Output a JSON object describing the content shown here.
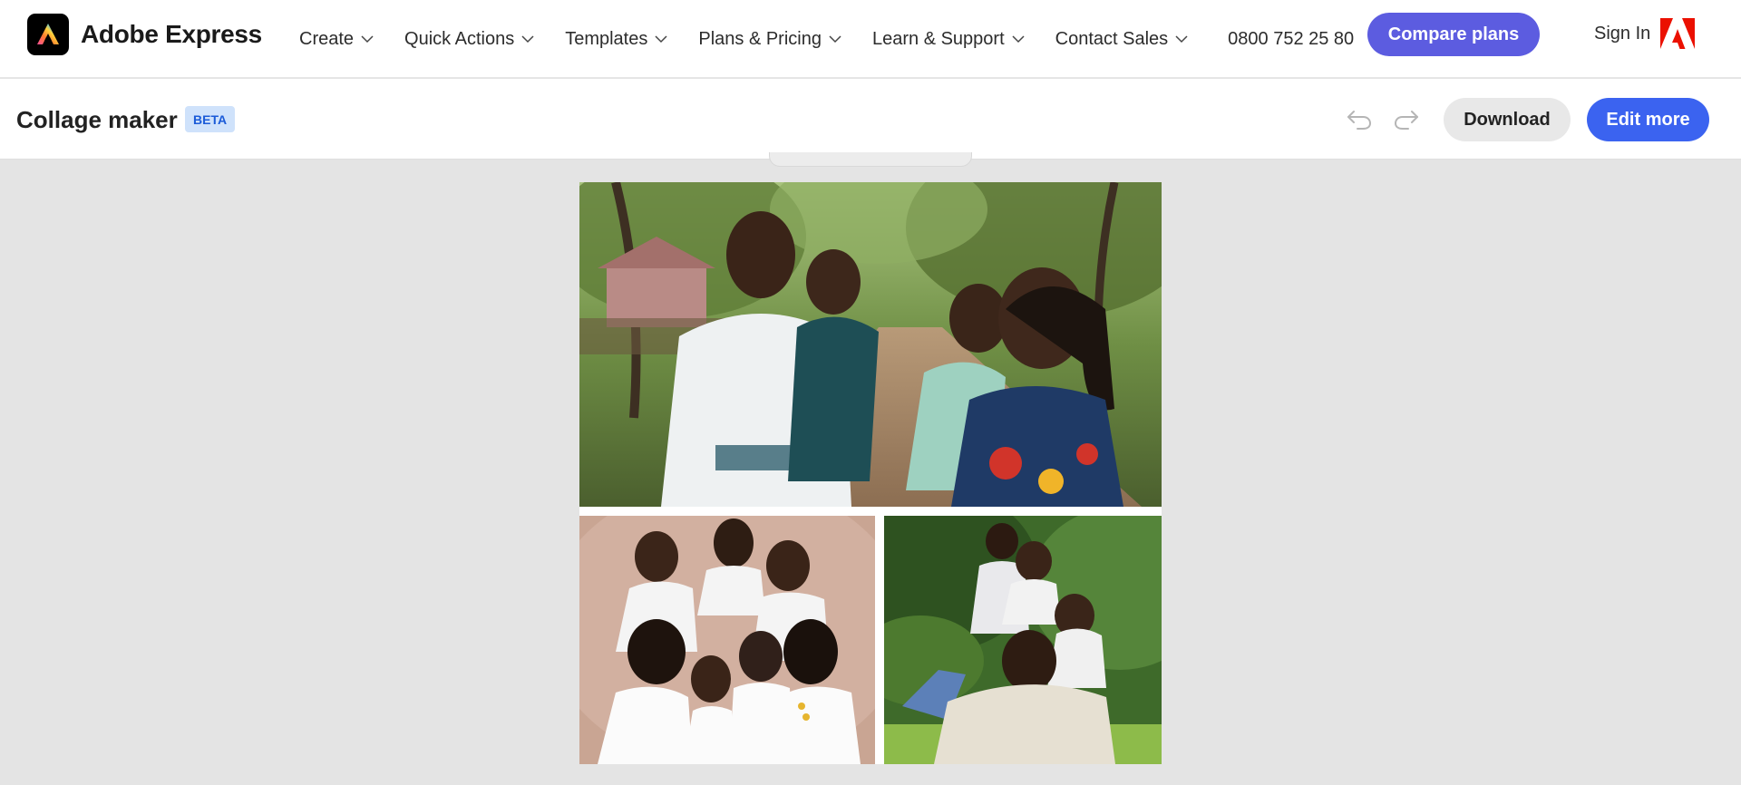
{
  "brand": {
    "name": "Adobe Express",
    "logo_icon": "adobe-express-logo-icon"
  },
  "nav": {
    "items": [
      {
        "label": "Create"
      },
      {
        "label": "Quick Actions"
      },
      {
        "label": "Templates"
      },
      {
        "label": "Plans & Pricing"
      },
      {
        "label": "Learn & Support"
      },
      {
        "label": "Contact Sales"
      }
    ],
    "phone": "0800 752 25 80",
    "compare_label": "Compare plans",
    "signin_label": "Sign In"
  },
  "editor": {
    "title": "Collage maker",
    "badge": "BETA",
    "download_label": "Download",
    "edit_label": "Edit more"
  },
  "collage": {
    "layout": "one-top-two-bottom",
    "photos": [
      {
        "subject": "family of four outdoors on tree-lined path"
      },
      {
        "subject": "large family in white shirts studio portrait"
      },
      {
        "subject": "father and children lying on grass"
      }
    ]
  },
  "colors": {
    "accent": "#5c5ce0",
    "primary_button": "#3b63f0",
    "beta_bg": "#cfe2fb",
    "beta_text": "#1b5bd8",
    "adobe_red": "#eb1000",
    "canvas_bg": "#e4e4e4"
  }
}
